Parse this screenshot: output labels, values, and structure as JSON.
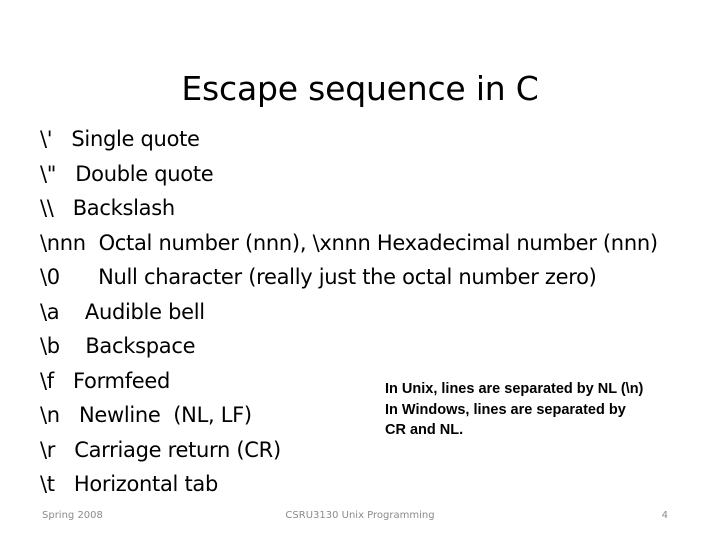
{
  "slide": {
    "title": "Escape sequence in C",
    "background_color": "#ffffff",
    "text_color": "#000000"
  },
  "escape_sequences": [
    {
      "code": "\\'",
      "gap": "   ",
      "description": "Single quote"
    },
    {
      "code": "\\\"",
      "gap": "   ",
      "description": "Double quote"
    },
    {
      "code": "\\\\",
      "gap": "   ",
      "description": "Backslash"
    },
    {
      "code": "\\nnn",
      "gap": "  ",
      "description": "Octal number (nnn), \\xnnn Hexadecimal number (nnn)"
    },
    {
      "code": "\\0",
      "gap": "      ",
      "description": "Null character (really just the octal number zero)"
    },
    {
      "code": "\\a",
      "gap": "    ",
      "description": "Audible bell"
    },
    {
      "code": "\\b",
      "gap": "    ",
      "description": "Backspace"
    },
    {
      "code": "\\f",
      "gap": "   ",
      "description": "Formfeed"
    },
    {
      "code": "\\n",
      "gap": "   ",
      "description": "Newline  (NL, LF)"
    },
    {
      "code": "\\r",
      "gap": "   ",
      "description": "Carriage return (CR)"
    },
    {
      "code": "\\t",
      "gap": "   ",
      "description": "Horizontal tab"
    }
  ],
  "side_note": {
    "lines": [
      "In Unix, lines are separated by NL (\\n)",
      "In Windows, lines are separated by",
      "CR and NL."
    ]
  },
  "footer": {
    "date": "Spring 2008",
    "course": "CSRU3130 Unix Programming",
    "page_number": "4",
    "color": "#8c8c8c"
  }
}
